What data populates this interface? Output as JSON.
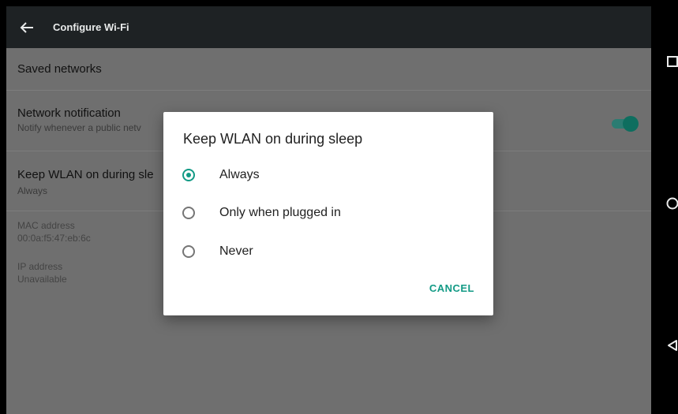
{
  "toolbar": {
    "title": "Configure Wi-Fi"
  },
  "settings": {
    "saved_networks": "Saved networks",
    "network_notification": {
      "title": "Network notification",
      "subtitle": "Notify whenever a public netv"
    },
    "keep_wlan": {
      "title": "Keep WLAN on during sle",
      "subtitle": "Always"
    },
    "mac": {
      "label": "MAC address",
      "value": "00:0a:f5:47:eb:6c"
    },
    "ip": {
      "label": "IP address",
      "value": "Unavailable"
    }
  },
  "dialog": {
    "title": "Keep WLAN on during sleep",
    "options": [
      "Always",
      "Only when plugged in",
      "Never"
    ],
    "selected_index": 0,
    "cancel_label": "CANCEL"
  },
  "colors": {
    "accent": "#129a85",
    "toolbar": "#1e2224",
    "dim_background": "#6f6f6f"
  },
  "icons": {
    "toolbar": "back-arrow-icon",
    "nav": [
      "recents-square-icon",
      "home-circle-icon",
      "back-triangle-icon"
    ]
  }
}
